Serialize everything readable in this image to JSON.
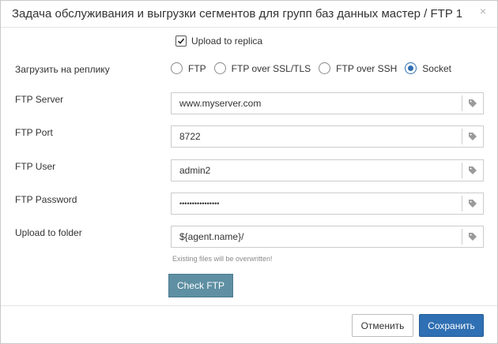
{
  "dialog": {
    "title": "Задача обслуживания и выгрузки сегментов для групп баз данных мастер / FTP 1",
    "close_symbol": "×"
  },
  "upload_to_replica": {
    "label": "Upload to replica",
    "checked": true
  },
  "protocol": {
    "label": "Загрузить на реплику",
    "options": [
      "FTP",
      "FTP over SSL/TLS",
      "FTP over SSH",
      "Socket"
    ],
    "selected": "Socket"
  },
  "fields": {
    "server": {
      "label": "FTP Server",
      "value": "www.myserver.com"
    },
    "port": {
      "label": "FTP Port",
      "value": "8722"
    },
    "user": {
      "label": "FTP User",
      "value": "admin2"
    },
    "password": {
      "label": "FTP Password",
      "value": "••••••••••••••••"
    },
    "folder": {
      "label": "Upload to folder",
      "value": "${agent.name}/"
    }
  },
  "folder_hint": "Existing files will be overwritten!",
  "check_ftp_label": "Check FTP",
  "footer": {
    "cancel_label": "Отменить",
    "save_label": "Сохранить"
  },
  "icons": {
    "field_addon": "tag-icon",
    "checkbox_mark": "checkmark-icon"
  },
  "colors": {
    "primary": "#2f6fb3",
    "check_button": "#5e8fa3"
  }
}
